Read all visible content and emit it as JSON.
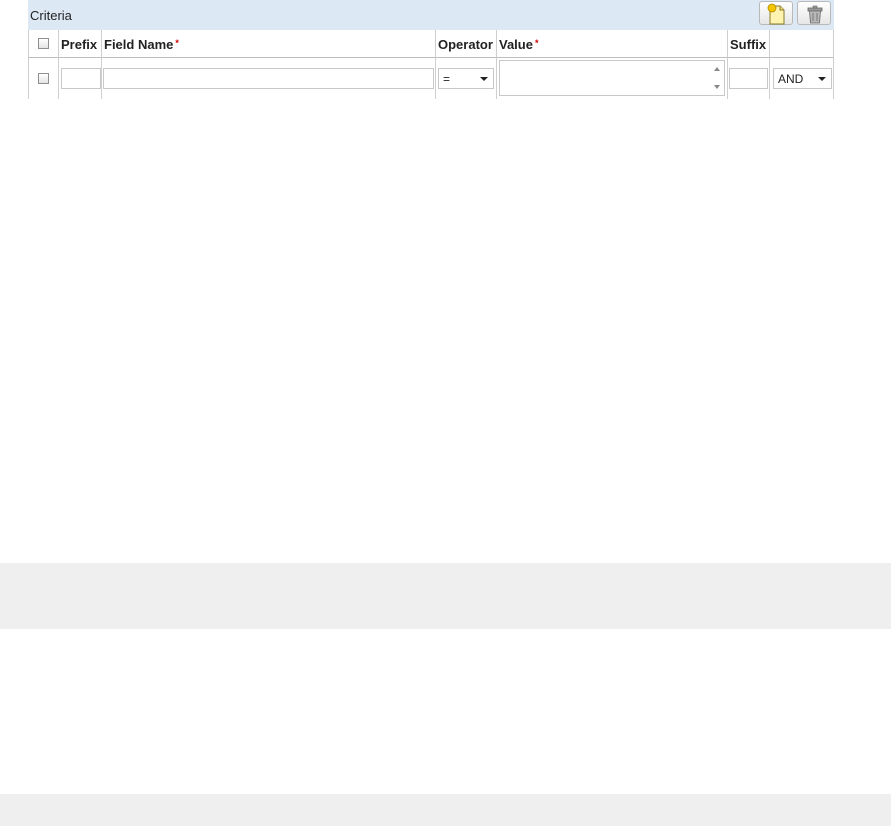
{
  "criteria": {
    "title": "Criteria",
    "add_button_icon": "add-document-icon",
    "delete_button_icon": "trash-can-icon"
  },
  "table": {
    "columns": {
      "prefix": "Prefix",
      "field_name": "Field Name",
      "operator": "Operator",
      "value": "Value",
      "suffix": "Suffix"
    },
    "required_marker": "*",
    "row": {
      "prefix": "",
      "field_name": "",
      "operator": "=",
      "value": "",
      "suffix": "",
      "conjunction": "AND"
    }
  },
  "colors": {
    "header_bg": "#dde8f5",
    "band_bg": "#efefef",
    "required": "#d10000"
  }
}
